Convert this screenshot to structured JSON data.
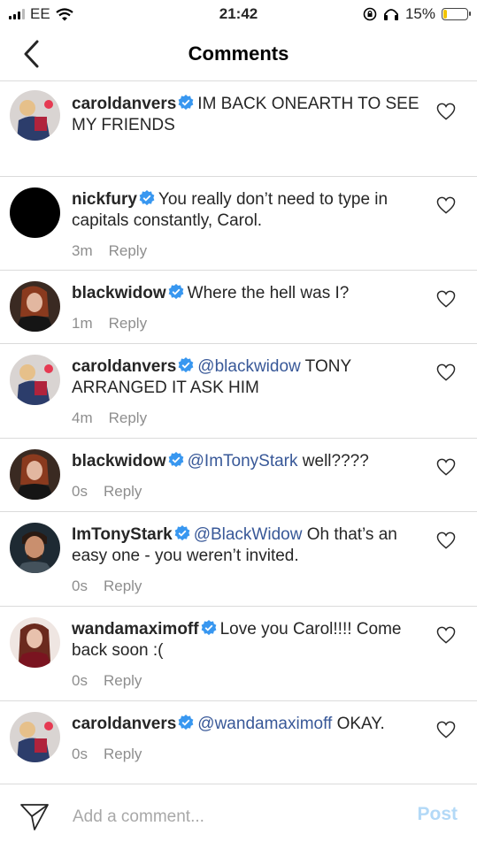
{
  "status_bar": {
    "carrier": "EE",
    "time": "21:42",
    "battery": "15%",
    "battery_level": 0.15,
    "icons": [
      "signal-icon",
      "wifi-icon",
      "orientation-lock-icon",
      "headphones-icon",
      "battery-icon"
    ]
  },
  "header": {
    "title": "Comments",
    "back_icon": "chevron-left-icon"
  },
  "reply_label": "Reply",
  "comments": [
    {
      "username": "caroldanvers",
      "mention": "",
      "text": "IM BACK ONEARTH TO SEE MY FRIENDS",
      "time": "",
      "avatar_icon": "carol-avatar"
    },
    {
      "username": "nickfury",
      "mention": "",
      "text": "You really don’t need to type in capitals constantly, Carol.",
      "time": "3m",
      "avatar_icon": "nickfury-avatar"
    },
    {
      "username": "blackwidow",
      "mention": "",
      "text": "Where the hell was I?",
      "time": "1m",
      "avatar_icon": "blackwidow-avatar"
    },
    {
      "username": "caroldanvers",
      "mention": "@blackwidow",
      "text": " TONY ARRANGED IT ASK HIM",
      "time": "4m",
      "avatar_icon": "carol-avatar"
    },
    {
      "username": "blackwidow",
      "mention": "@ImTonyStark",
      "text": " well????",
      "time": "0s",
      "avatar_icon": "blackwidow-avatar"
    },
    {
      "username": "ImTonyStark",
      "mention": "@BlackWidow",
      "text": " Oh that’s an easy one - you weren’t invited.",
      "time": "0s",
      "avatar_icon": "tonystark-avatar"
    },
    {
      "username": "wandamaximoff",
      "mention": "",
      "text": "Love you Carol!!!! Come back soon :(",
      "time": "0s",
      "avatar_icon": "wanda-avatar"
    },
    {
      "username": "caroldanvers",
      "mention": "@wandamaximoff",
      "text": " OKAY.",
      "time": "0s",
      "avatar_icon": "carol-avatar"
    }
  ],
  "footer": {
    "placeholder": "Add a comment...",
    "post_label": "Post",
    "send_icon": "direct-send-icon"
  },
  "colors": {
    "mention": "#385898",
    "verified": "#3897f0",
    "post_disabled": "#b3d9f7",
    "meta": "#8e8e8e",
    "divider": "#dbdbdb"
  }
}
